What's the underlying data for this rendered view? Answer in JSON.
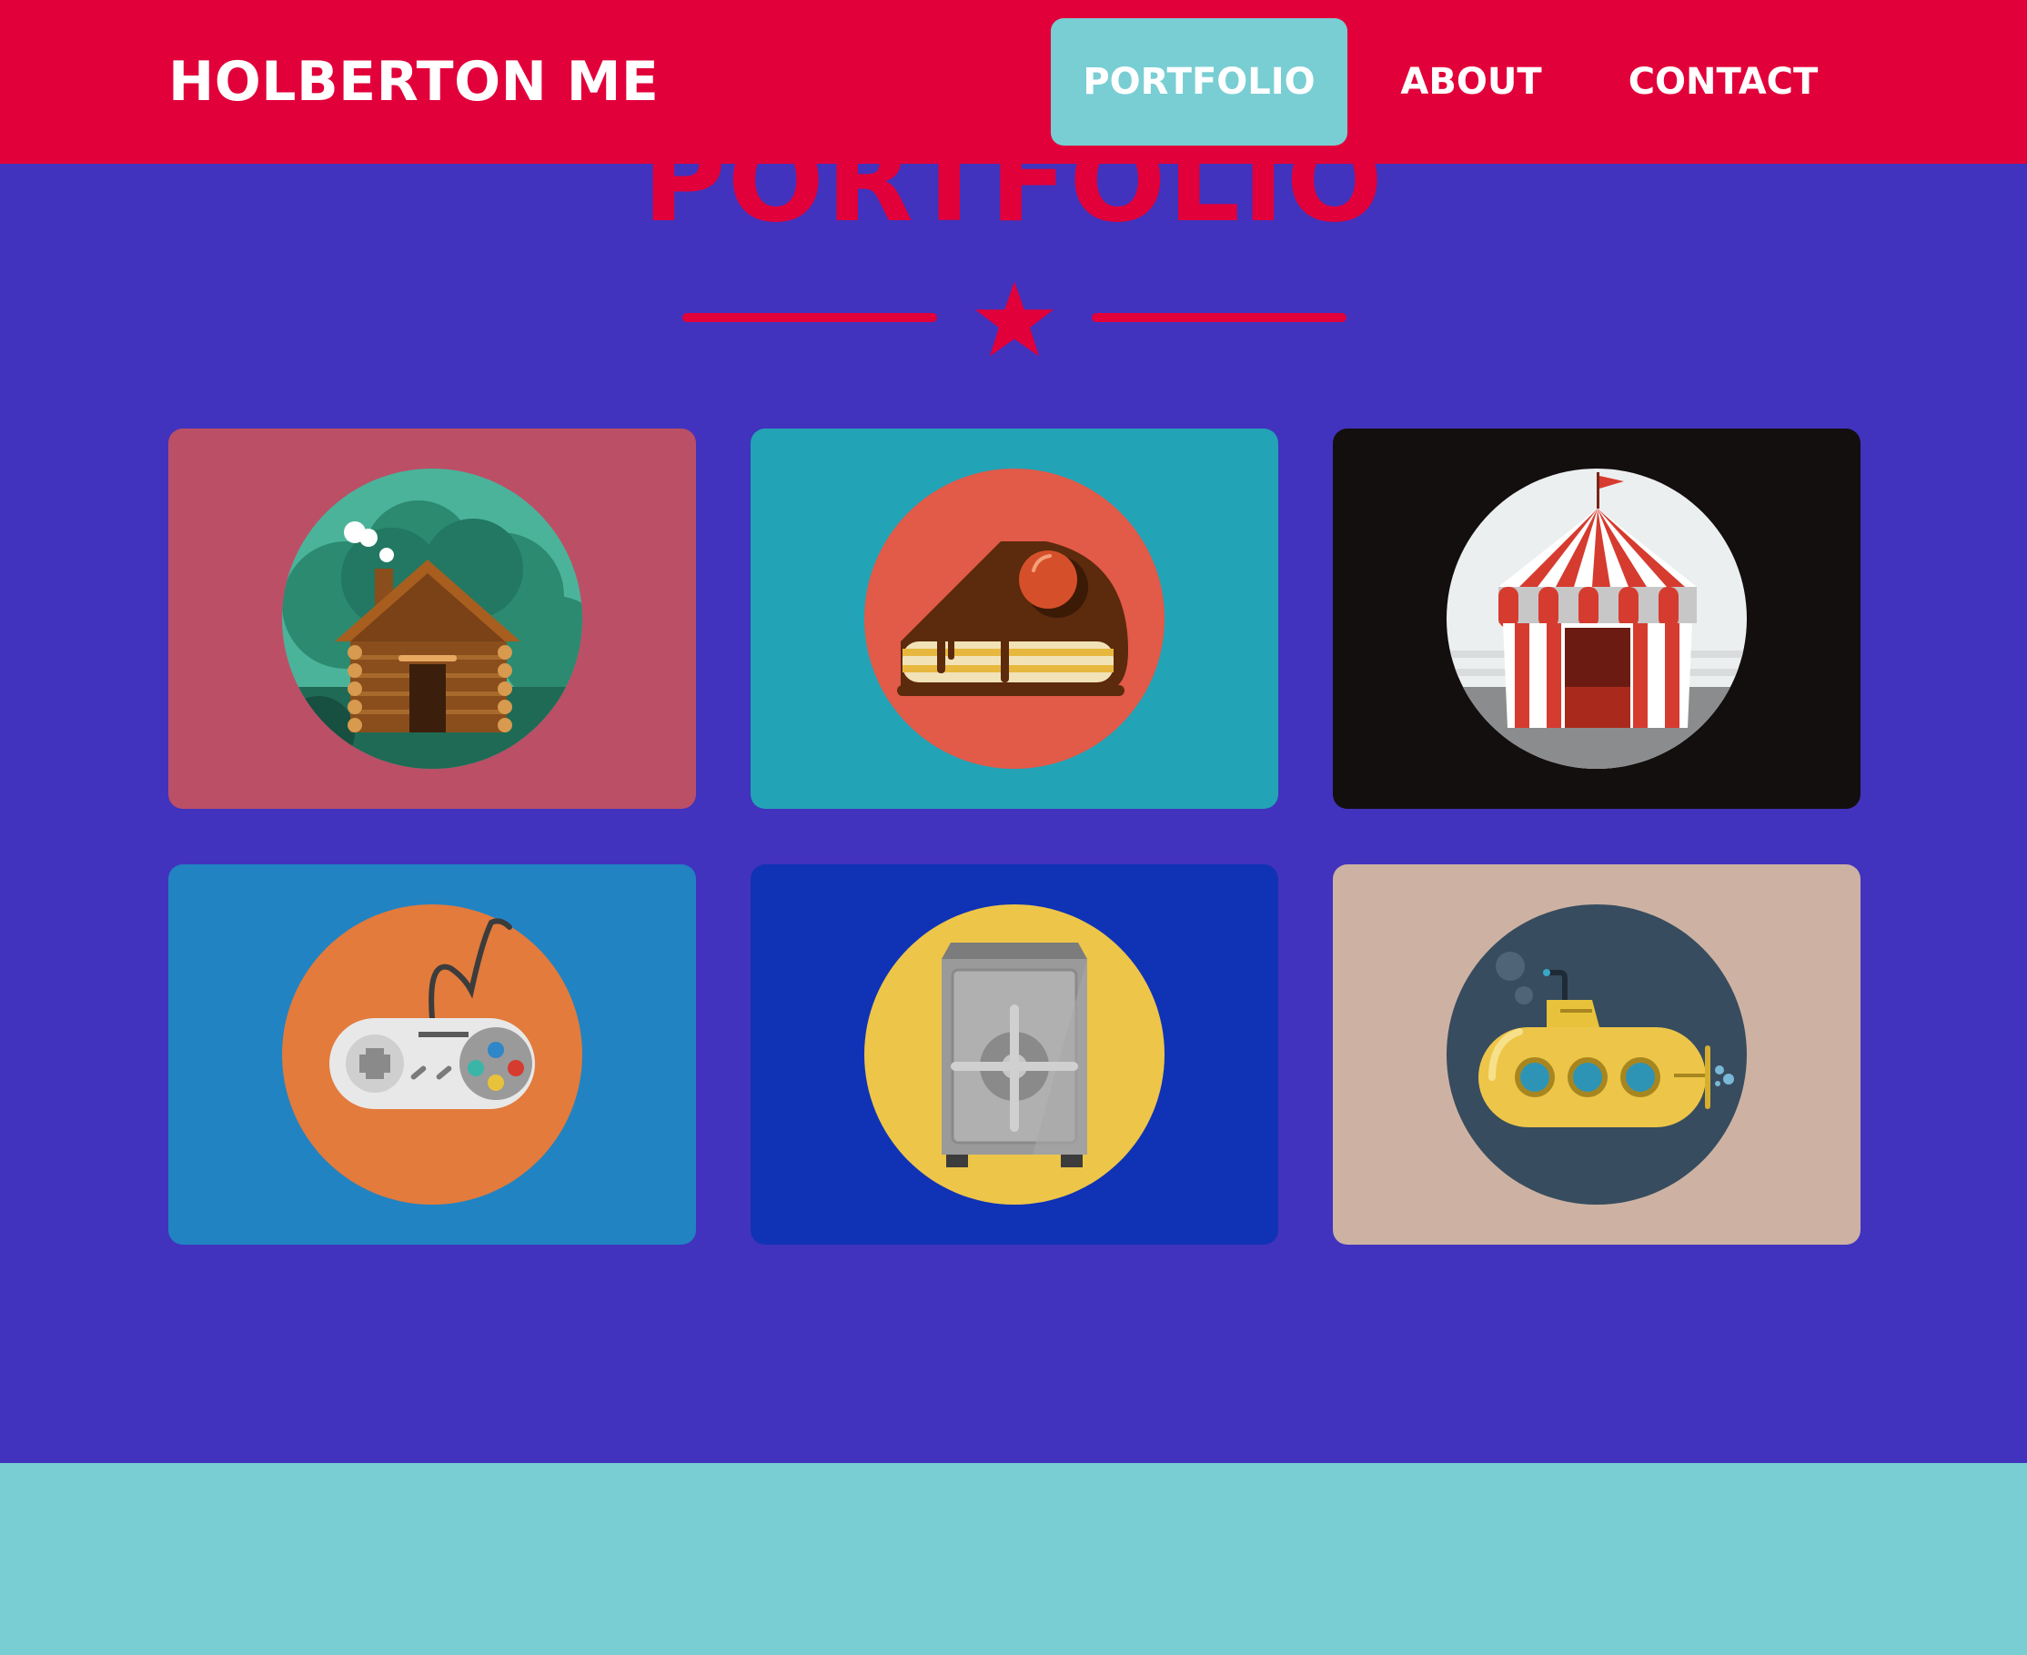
{
  "navbar": {
    "brand": "HOLBERTON ME",
    "links": [
      {
        "label": "PORTFOLIO",
        "active": true
      },
      {
        "label": "ABOUT",
        "active": false
      },
      {
        "label": "CONTACT",
        "active": false
      }
    ]
  },
  "portfolio": {
    "title": "PORTFOLIO",
    "divider_icon": "star-icon",
    "items": [
      {
        "icon": "cabin-icon",
        "bg_color": "#bb4f66",
        "circle_color": "#2e8f76"
      },
      {
        "icon": "cake-icon",
        "bg_color": "#22a3b6",
        "circle_color": "#e25a48"
      },
      {
        "icon": "circus-tent-icon",
        "bg_color": "#130f0e",
        "circle_color": "#ecefef"
      },
      {
        "icon": "game-controller-icon",
        "bg_color": "#2183c2",
        "circle_color": "#e27b3c"
      },
      {
        "icon": "safe-icon",
        "bg_color": "#1033b5",
        "circle_color": "#edc548"
      },
      {
        "icon": "submarine-icon",
        "bg_color": "#cdb2a3",
        "circle_color": "#374c5e"
      }
    ]
  },
  "colors": {
    "page_bg": "#4133bd",
    "nav_bg": "#e1003a",
    "accent": "#79ced3",
    "title": "#e1003a"
  }
}
